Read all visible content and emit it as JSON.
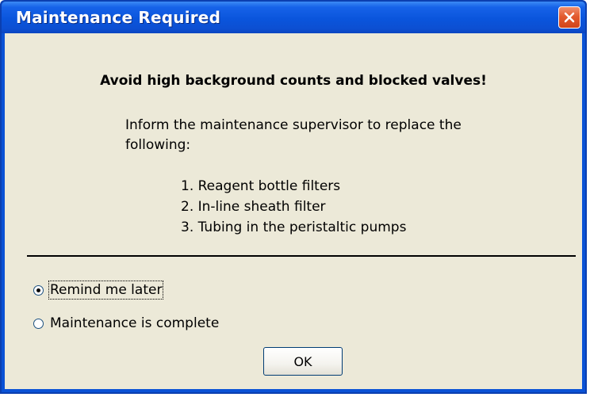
{
  "window": {
    "title": "Maintenance Required",
    "close_icon": "close-icon"
  },
  "message": {
    "headline": "Avoid high background counts and blocked valves!",
    "intro": "Inform the maintenance supervisor to replace the following:",
    "items": [
      "1. Reagent bottle filters",
      "2. In-line sheath filter",
      "3. Tubing in the peristaltic pumps"
    ]
  },
  "options": {
    "remind_later": {
      "label": "Remind me later",
      "selected": true
    },
    "complete": {
      "label": "Maintenance is complete",
      "selected": false
    }
  },
  "buttons": {
    "ok_label": "OK"
  },
  "colors": {
    "title_bar": "#0a55dc",
    "close_button": "#e35a2e",
    "dialog_background": "#ece9d8"
  }
}
